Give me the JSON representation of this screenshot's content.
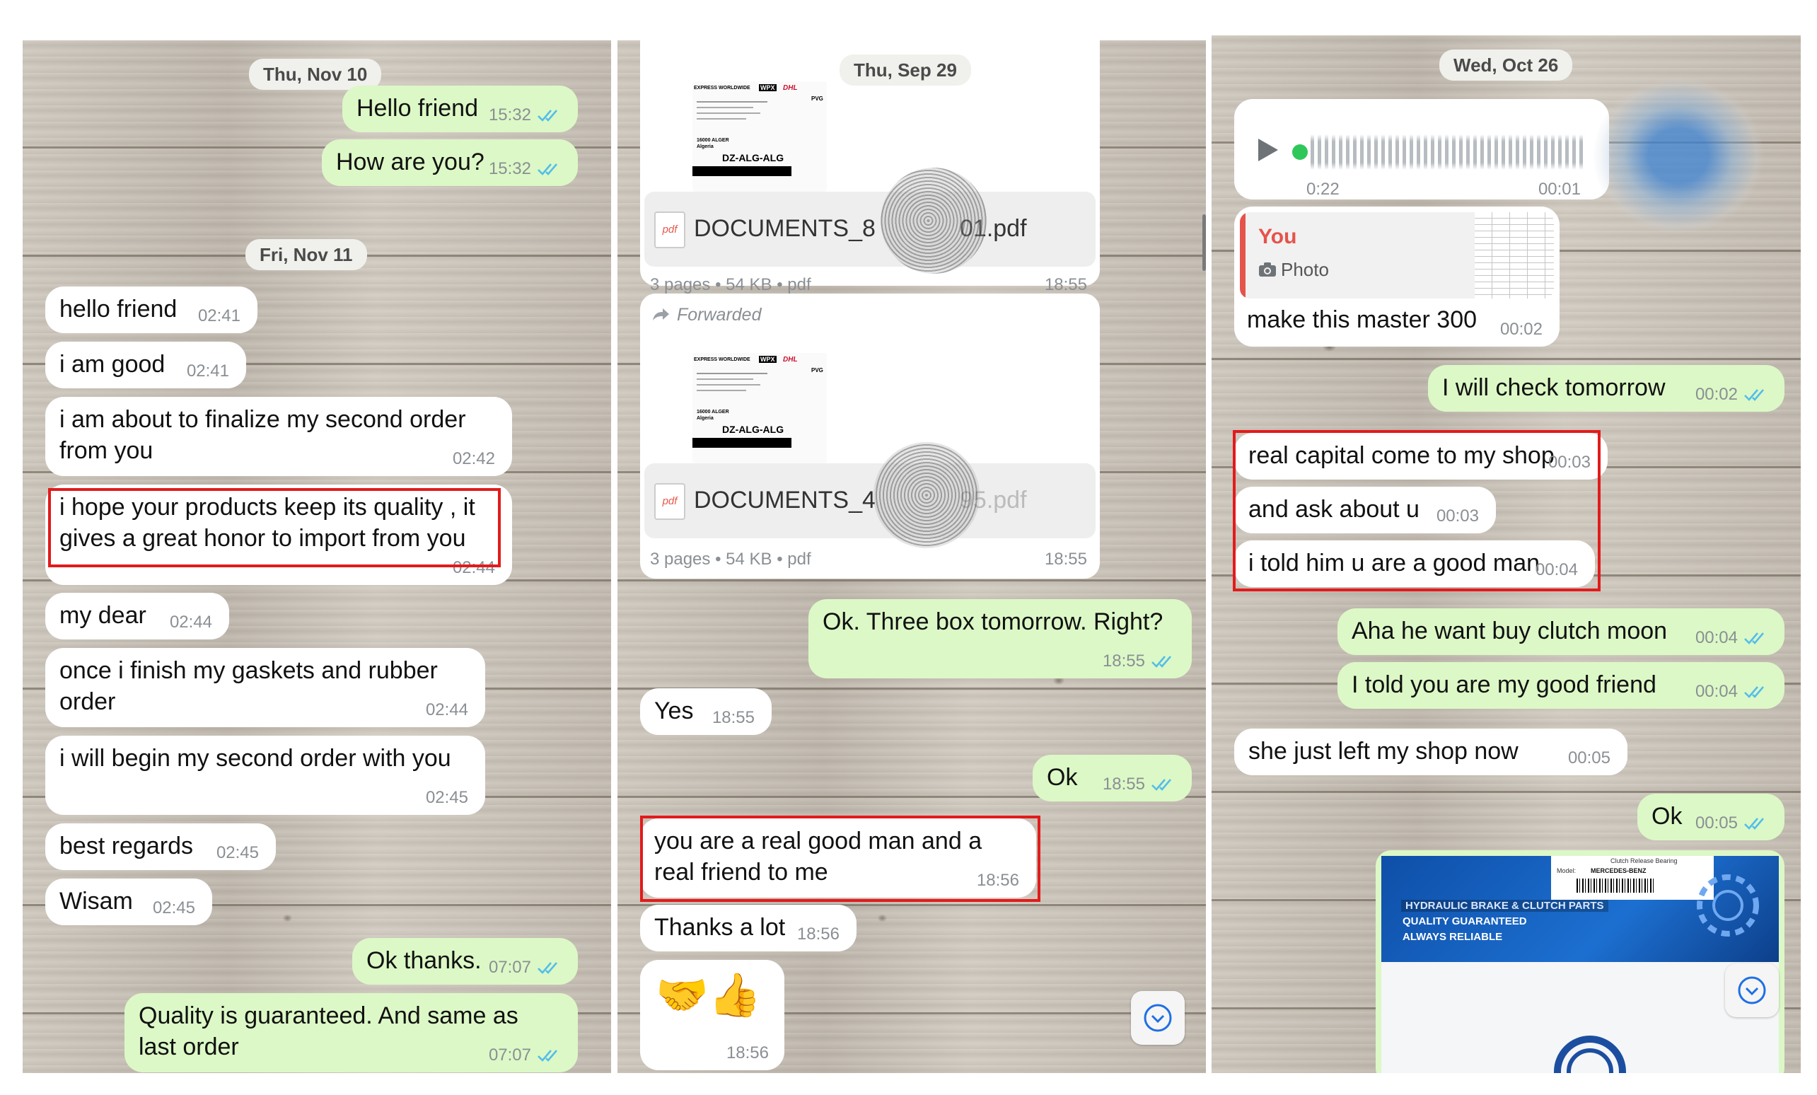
{
  "panel1": {
    "dates": [
      "Thu, Nov 10",
      "Fri, Nov 11"
    ],
    "messages": [
      {
        "text": "Hello friend",
        "time": "15:32"
      },
      {
        "text": "How are you?",
        "time": "15:32"
      },
      {
        "text": "hello friend",
        "time": "02:41"
      },
      {
        "text": "i am good",
        "time": "02:41"
      },
      {
        "text": "i am about to finalize my second order from you",
        "time": "02:42"
      },
      {
        "text": "i hope your products keep its quality , it gives a great honor to import from you",
        "time": "02:44"
      },
      {
        "text": "my dear",
        "time": "02:44"
      },
      {
        "text": "once i finish my gaskets and rubber order",
        "time": "02:44"
      },
      {
        "text": "i will begin my second order with you",
        "time": "02:45"
      },
      {
        "text": "best regards",
        "time": "02:45"
      },
      {
        "text": "Wisam",
        "time": "02:45"
      },
      {
        "text": "Ok thanks.",
        "time": "07:07"
      },
      {
        "text": "Quality is guaranteed. And same as last order",
        "time": "07:07"
      }
    ]
  },
  "panel2": {
    "date": "Thu, Sep 29",
    "doc1": {
      "name": "DOCUMENTS_8",
      "name_end": "01.pdf",
      "meta": "3 pages • 54 KB • pdf",
      "time": "18:55"
    },
    "forwarded_label": "Forwarded",
    "doc2": {
      "name": "DOCUMENTS_4",
      "name_end": "95.pdf",
      "meta": "3 pages • 54 KB • pdf",
      "time": "18:55"
    },
    "waybill": {
      "line1": "EXPRESS WORLDWIDE",
      "badge": "WPX",
      "brand": "DHL",
      "city": "16000 ALGER",
      "country": "Algeria",
      "route": "DZ-ALG-ALG",
      "code": "PVG"
    },
    "messages": [
      {
        "text": "Ok. Three box tomorrow. Right?",
        "time": "18:55"
      },
      {
        "text": "Yes",
        "time": "18:55"
      },
      {
        "text": "Ok",
        "time": "18:55"
      },
      {
        "text": "you are a real good man and a real friend to me",
        "time": "18:56"
      },
      {
        "text": "Thanks a lot",
        "time": "18:56"
      },
      {
        "text": "🤝👍",
        "time": "18:56"
      }
    ]
  },
  "panel3": {
    "date": "Wed, Oct 26",
    "voice": {
      "elapsed": "0:22",
      "time": "00:01"
    },
    "reply": {
      "sender": "You",
      "type": "Photo",
      "text": "make this master 300",
      "time": "00:02"
    },
    "product": {
      "line1": "HYDRAULIC BRAKE & CLUTCH PARTS",
      "line2": "QUALITY GUARANTEED",
      "line3": "ALWAYS RELIABLE",
      "label_model": "Model:",
      "label_model_value": "MERCEDES-BENZ",
      "label_top": "Clutch Release Bearing"
    },
    "messages": [
      {
        "text": "I will check tomorrow",
        "time": "00:02"
      },
      {
        "text": "real capital come to my shop",
        "time": "00:03"
      },
      {
        "text": "and ask about u",
        "time": "00:03"
      },
      {
        "text": "i told him u are a good man",
        "time": "00:04"
      },
      {
        "text": "Aha he want buy clutch moon",
        "time": "00:04"
      },
      {
        "text": "I told you are my good friend",
        "time": "00:04"
      },
      {
        "text": "she just left my shop now",
        "time": "00:05"
      },
      {
        "text": "Ok",
        "time": "00:05"
      }
    ]
  },
  "colors": {
    "incoming": "#ffffff",
    "outgoing": "#dcf8c6",
    "highlight": "#e21b1b",
    "tick": "#53bdeb"
  }
}
